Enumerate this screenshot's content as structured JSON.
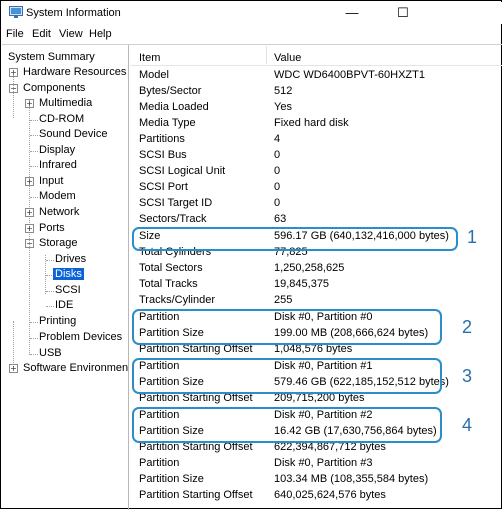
{
  "window": {
    "title": "System Information",
    "minimize": "—",
    "maximize": "☐"
  },
  "menu": [
    "File",
    "Edit",
    "View",
    "Help"
  ],
  "tree": {
    "system_summary": "System Summary",
    "hardware_resources": "Hardware Resources",
    "components": "Components",
    "multimedia": "Multimedia",
    "cdrom": "CD-ROM",
    "sound_device": "Sound Device",
    "display": "Display",
    "infrared": "Infrared",
    "input": "Input",
    "modem": "Modem",
    "network": "Network",
    "ports": "Ports",
    "storage": "Storage",
    "drives": "Drives",
    "disks": "Disks",
    "scsi": "SCSI",
    "ide": "IDE",
    "printing": "Printing",
    "problem_devices": "Problem Devices",
    "usb": "USB",
    "software_environment": "Software Environment",
    "expand_glyph": "+",
    "collapse_glyph": "−"
  },
  "table": {
    "headers": {
      "item": "Item",
      "value": "Value"
    },
    "rows": [
      {
        "item": "Model",
        "value": "WDC WD6400BPVT-60HXZT1"
      },
      {
        "item": "Bytes/Sector",
        "value": "512"
      },
      {
        "item": "Media Loaded",
        "value": "Yes"
      },
      {
        "item": "Media Type",
        "value": "Fixed hard disk"
      },
      {
        "item": "Partitions",
        "value": "4"
      },
      {
        "item": "SCSI Bus",
        "value": "0"
      },
      {
        "item": "SCSI Logical Unit",
        "value": "0"
      },
      {
        "item": "SCSI Port",
        "value": "0"
      },
      {
        "item": "SCSI Target ID",
        "value": "0"
      },
      {
        "item": "Sectors/Track",
        "value": "63"
      },
      {
        "item": "Size",
        "value": "596.17 GB (640,132,416,000 bytes)"
      },
      {
        "item": "Total Cylinders",
        "value": "77,825"
      },
      {
        "item": "Total Sectors",
        "value": "1,250,258,625"
      },
      {
        "item": "Total Tracks",
        "value": "19,845,375"
      },
      {
        "item": "Tracks/Cylinder",
        "value": "255"
      },
      {
        "item": "Partition",
        "value": "Disk #0, Partition #0"
      },
      {
        "item": "Partition Size",
        "value": "199.00 MB (208,666,624 bytes)"
      },
      {
        "item": "Partition Starting Offset",
        "value": "1,048,576 bytes"
      },
      {
        "item": "Partition",
        "value": "Disk #0, Partition #1"
      },
      {
        "item": "Partition Size",
        "value": "579.46 GB (622,185,152,512 bytes)"
      },
      {
        "item": "Partition Starting Offset",
        "value": "209,715,200 bytes"
      },
      {
        "item": "Partition",
        "value": "Disk #0, Partition #2"
      },
      {
        "item": "Partition Size",
        "value": "16.42 GB (17,630,756,864 bytes)"
      },
      {
        "item": "Partition Starting Offset",
        "value": "622,394,867,712 bytes"
      },
      {
        "item": "Partition",
        "value": "Disk #0, Partition #3"
      },
      {
        "item": "Partition Size",
        "value": "103.34 MB (108,355,584 bytes)"
      },
      {
        "item": "Partition Starting Offset",
        "value": "640,025,624,576 bytes"
      }
    ]
  },
  "highlights": [
    "1",
    "2",
    "3",
    "4"
  ],
  "colors": {
    "highlight_border": "#2b8dc9",
    "highlight_number": "#2b6fa8",
    "selection": "#0a64d7"
  }
}
